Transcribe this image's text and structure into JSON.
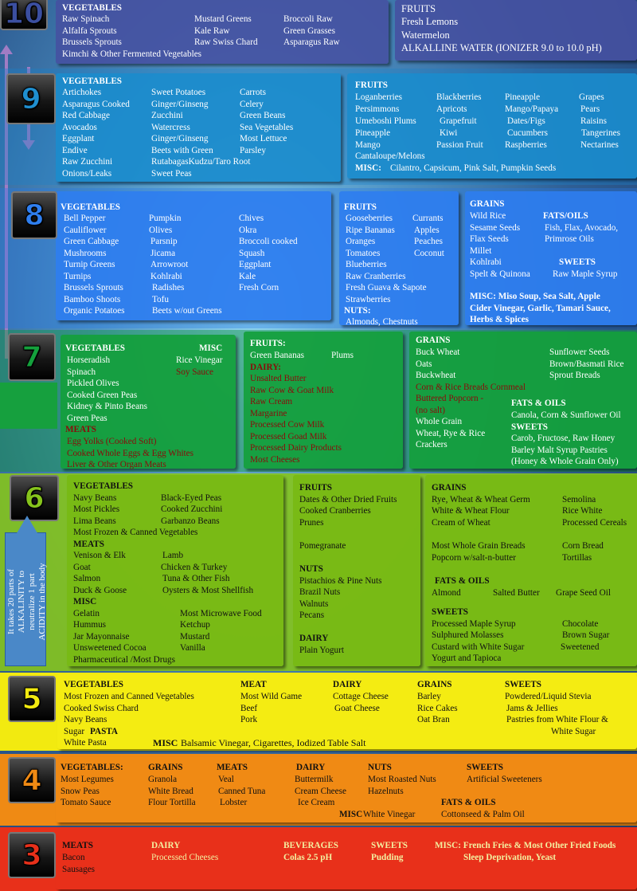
{
  "levels": {
    "l10": {
      "num": "10",
      "vegetables_heading": "VEGETABLES",
      "col1": [
        "Raw Spinach",
        "Alfalfa Sprouts",
        "Brussels Sprouts",
        "Kimchi & Other Fermented Vegetables"
      ],
      "col2": [
        "Mustard Greens",
        "Kale Raw",
        "Raw Swiss Chard"
      ],
      "col3": [
        "Broccoli Raw",
        "Green Grasses",
        "Asparagus Raw"
      ],
      "fruits": [
        "FRUITS",
        "Fresh Lemons",
        "Watermelon",
        "ALKALLINE WATER (IONIZER 9.0 to 10.0 pH)"
      ]
    },
    "l9": {
      "num": "9",
      "vegetables_heading": "VEGETABLES",
      "col1": [
        "Artichokes",
        "Asparagus Cooked",
        "Red Cabbage",
        "Avocados",
        "Eggplant",
        "Endive",
        "Raw Zucchini",
        "Onions/Leaks"
      ],
      "col2": [
        "Sweet Potatoes",
        "Ginger/Ginseng",
        "Zucchini",
        "Watercress",
        "Ginger/Ginseng",
        "Beets with Green",
        "RutabagasKudzu/Taro Root",
        "Sweet Peas"
      ],
      "col3": [
        "Carrots",
        "Celery",
        "Green Beans",
        "Sea Vegetables",
        "Most Lettuce",
        "Parsley"
      ],
      "fruits_heading": "FRUITS",
      "f1": [
        "Loganberries",
        "Persimmons",
        "Umeboshi Plums",
        "Pineapple",
        "Mango",
        "Cantaloupe/Melons"
      ],
      "f2": [
        "Blackberries",
        "Apricots",
        "Grapefruit",
        "Kiwi",
        "Passion Fruit"
      ],
      "f3": [
        "Pineapple",
        "Mango/Papaya",
        "Dates/Figs",
        "Cucumbers",
        "Raspberries"
      ],
      "f4": [
        "Grapes",
        "Pears",
        "Raisins",
        "Tangerines",
        "Nectarines"
      ],
      "misc_heading": "MISC:",
      "misc": "Cilantro, Capsicum, Pink Salt, Pumpkin Seeds"
    },
    "l8": {
      "num": "8",
      "vegetables_heading": "VEGETABLES",
      "col1": [
        "Bell Pepper",
        "Cauliflower",
        "Green Cabbage",
        "Mushrooms",
        "Turnip Greens",
        "Turnips",
        "Brussels Sprouts",
        "Bamboo Shoots",
        "Organic Potatoes"
      ],
      "col2": [
        "Pumpkin",
        "Olives",
        "Parsnip",
        "Jicama",
        "Arrowroot",
        "Kohlrabi",
        "Radishes",
        "Tofu",
        "Beets w/out Greens"
      ],
      "col3": [
        "Chives",
        "Okra",
        "Broccoli cooked",
        "Squash",
        "Eggplant",
        "Kale",
        "Fresh Corn"
      ],
      "fruits_heading": "FRUITS",
      "f1": [
        "Gooseberries",
        "Ripe Bananas",
        "Oranges",
        "Tomatoes",
        "Blueberries",
        "Raw Cranberries",
        "Fresh Guava & Sapote",
        "Strawberries"
      ],
      "f2": [
        "Currants",
        "Apples",
        "Peaches",
        "Coconut"
      ],
      "nuts_heading": "NUTS:",
      "nuts": "Almonds, Chestnuts",
      "grains_heading": "GRAINS",
      "grains": [
        "Wild Rice",
        "Sesame Seeds",
        "Flax Seeds",
        "Millet",
        "Kohlrabi",
        "Spelt & Quinona"
      ],
      "fats_heading": "FATS/OILS",
      "fats": [
        "Fish, Flax, Avocado,",
        "Primrose Oils"
      ],
      "sweets_heading": "SWEETS",
      "sweets": "Raw Maple Syrup",
      "misc": [
        "MISC: Miso Soup, Sea Salt, Apple",
        "Cider Vinegar, Garlic, Tamari Sauce,",
        "Herbs & Spices"
      ]
    },
    "l7": {
      "num": "7",
      "vegetables_heading": "VEGETABLES",
      "veg": [
        "Horseradish",
        "Spinach",
        "Pickled Olives",
        "Cooked Green Peas",
        "Kidney & Pinto Beans",
        "Green Peas"
      ],
      "misc_heading": "MISC",
      "misc": [
        "Rice Vinegar",
        "Soy Sauce"
      ],
      "meats_heading": "MEATS",
      "meats": [
        "Egg Yolks (Cooked Soft)",
        "Cooked Whole Eggs & Egg Whites",
        "Liver & Other Organ Meats"
      ],
      "fruits_heading": "FRUITS:",
      "fruits": [
        "Green Bananas",
        "Plums"
      ],
      "dairy_heading": "DAIRY:",
      "dairy": [
        "Unsalted Butter",
        "Raw Cow & Goat Milk",
        "Raw Cream",
        "Margarine",
        "Processed Cow Milk",
        "Processed Goad Milk",
        "Processed Dairy Products",
        "Most Cheeses"
      ],
      "grains_heading": "GRAINS",
      "grains": [
        "Buck Wheat",
        "Oats",
        "Buckwheat"
      ],
      "grains_red": [
        "Corn & Rice Breads Cornmeal",
        "Buttered Popcorn -",
        "(no salt)"
      ],
      "grains2": [
        "Whole Grain",
        "Wheat, Rye & Rice",
        "Crackers"
      ],
      "seeds": [
        "Sunflower Seeds",
        "Brown/Basmati Rice",
        "Sprout Breads"
      ],
      "fats_heading": "FATS & OILS",
      "fats": "Canola, Corn & Sunflower Oil",
      "sweets_heading": "SWEETS",
      "sweets": [
        "Carob, Fructose, Raw Honey",
        "Barley Malt Syrup Pastries",
        "(Honey & Whole Grain Only)"
      ]
    },
    "l6": {
      "num": "6",
      "vegetables_heading": "VEGETABLES",
      "veg1": [
        "Navy Beans",
        "Most Pickles",
        "Lima Beans",
        "Most Frozen & Canned Vegetables"
      ],
      "veg2": [
        "Black-Eyed Peas",
        "Cooked Zucchini",
        "Garbanzo Beans"
      ],
      "meats_heading": "MEATS",
      "meats1": [
        "Venison & Elk",
        "Goat",
        "Salmon",
        "Duck & Goose"
      ],
      "meats2": [
        "Lamb",
        "Chicken & Turkey",
        "Tuna & Other Fish",
        "Oysters & Most Shellfish"
      ],
      "misc_heading": "MISC",
      "misc1": [
        "Gelatin",
        "Hummus",
        "Jar Mayonnaise",
        "Unsweetened Cocoa",
        "Pharmaceutical /Most Drugs"
      ],
      "misc2": [
        "Most Microwave Food",
        "Ketchup",
        "Mustard",
        "Vanilla"
      ],
      "fruits_heading": "FRUITS",
      "fruits": [
        "Dates & Other Dried Fruits",
        "Cooked Cranberries",
        "Prunes"
      ],
      "pomegranate": "Pomegranate",
      "nuts_heading": "NUTS",
      "nuts": [
        "Pistachios & Pine Nuts",
        "Brazil Nuts",
        "Walnuts",
        "Pecans"
      ],
      "dairy_heading": "DAIRY",
      "dairy": "Plain Yogurt",
      "grains_heading": "GRAINS",
      "grains": [
        "Rye, Wheat & Wheat Germ",
        "White & Wheat Flour",
        "Cream of Wheat"
      ],
      "grains_r": [
        "Semolina",
        "Rice White",
        "Processed Cereals"
      ],
      "grains_b": [
        "Most Whole Grain Breads",
        "Popcorn w/salt-n-butter"
      ],
      "grains_b2": [
        "Corn Bread",
        "Tortillas"
      ],
      "fats_heading": "FATS & OILS",
      "fats": [
        "Almond",
        "Salted Butter",
        "Grape Seed Oil"
      ],
      "sweets_heading": "SWEETS",
      "sweets": [
        "Processed Maple Syrup",
        "Sulphured Molasses",
        "Custard with White Sugar",
        "Yogurt and Tapioca"
      ],
      "sweets2": [
        "Chocolate",
        "Brown Sugar",
        "Sweetened"
      ]
    },
    "l5": {
      "num": "5",
      "vegetables_heading": "VEGETABLES",
      "veg": [
        "Most Frozen and Canned Vegetables",
        "Cooked Swiss Chard",
        "Navy Beans"
      ],
      "sugar": "Sugar",
      "pasta_heading": "PASTA",
      "pasta": "White Pasta",
      "meat_heading": "MEAT",
      "meat": [
        "Most Wild Game",
        "Beef",
        "Pork"
      ],
      "dairy_heading": "DAIRY",
      "dairy": [
        "Cottage Cheese",
        "Goat Cheese"
      ],
      "grains_heading": "GRAINS",
      "grains": [
        "Barley",
        "Rice Cakes",
        "Oat Bran"
      ],
      "sweets_heading": "SWEETS",
      "sweets": [
        "Powdered/Liquid Stevia",
        "Jams & Jellies",
        "Pastries from White Flour &",
        "White Sugar"
      ],
      "misc_heading": "MISC",
      "misc": "Balsamic Vinegar, Cigarettes, Iodized Table Salt"
    },
    "l4": {
      "num": "4",
      "vegetables_heading": "VEGETABLES:",
      "veg": [
        "Most Legumes",
        "Snow Peas",
        "Tomato Sauce"
      ],
      "grains_heading": "GRAINS",
      "grains": [
        "Granola",
        "White Bread",
        "Flour Tortilla"
      ],
      "meats_heading": "MEATS",
      "meats": [
        "Veal",
        "Canned Tuna",
        "Lobster"
      ],
      "dairy_heading": "DAIRY",
      "dairy": [
        "Buttermilk",
        "Cream Cheese",
        "Ice Cream"
      ],
      "nuts_heading": "NUTS",
      "nuts": [
        "Most Roasted Nuts",
        "Hazelnuts"
      ],
      "sweets_heading": "SWEETS",
      "sweets": "Artificial Sweeteners",
      "fats_heading": "FATS & OILS",
      "fats": "Cottonseed & Palm Oil",
      "misc_heading": "MISC",
      "misc": "White Vinegar"
    },
    "l3": {
      "num": "3",
      "meats_heading": "MEATS",
      "meats": [
        "Bacon",
        "Sausages"
      ],
      "dairy_heading": "DAIRY",
      "dairy": "Processed Cheeses",
      "bev_heading": "BEVERAGES",
      "bev": "Colas 2.5 pH",
      "sweets_heading": "SWEETS",
      "sweets": "Pudding",
      "misc": [
        "MISC: French Fries & Most Other Fried Foods",
        "Sleep Deprivation, Yeast"
      ]
    }
  },
  "side_note": [
    "It takes 20 parts of",
    "ALKALINITY to",
    "neutralize 1 part",
    "ACIDITY in the body"
  ],
  "colors": {
    "l10": "#3b4fa0",
    "l9": "#1f8fd0",
    "l8": "#2f7ff0",
    "l7": "#14a03c",
    "l6": "#86c41c",
    "l5": "#f2ea10",
    "l4": "#ef8a14",
    "l3": "#e8301a"
  }
}
